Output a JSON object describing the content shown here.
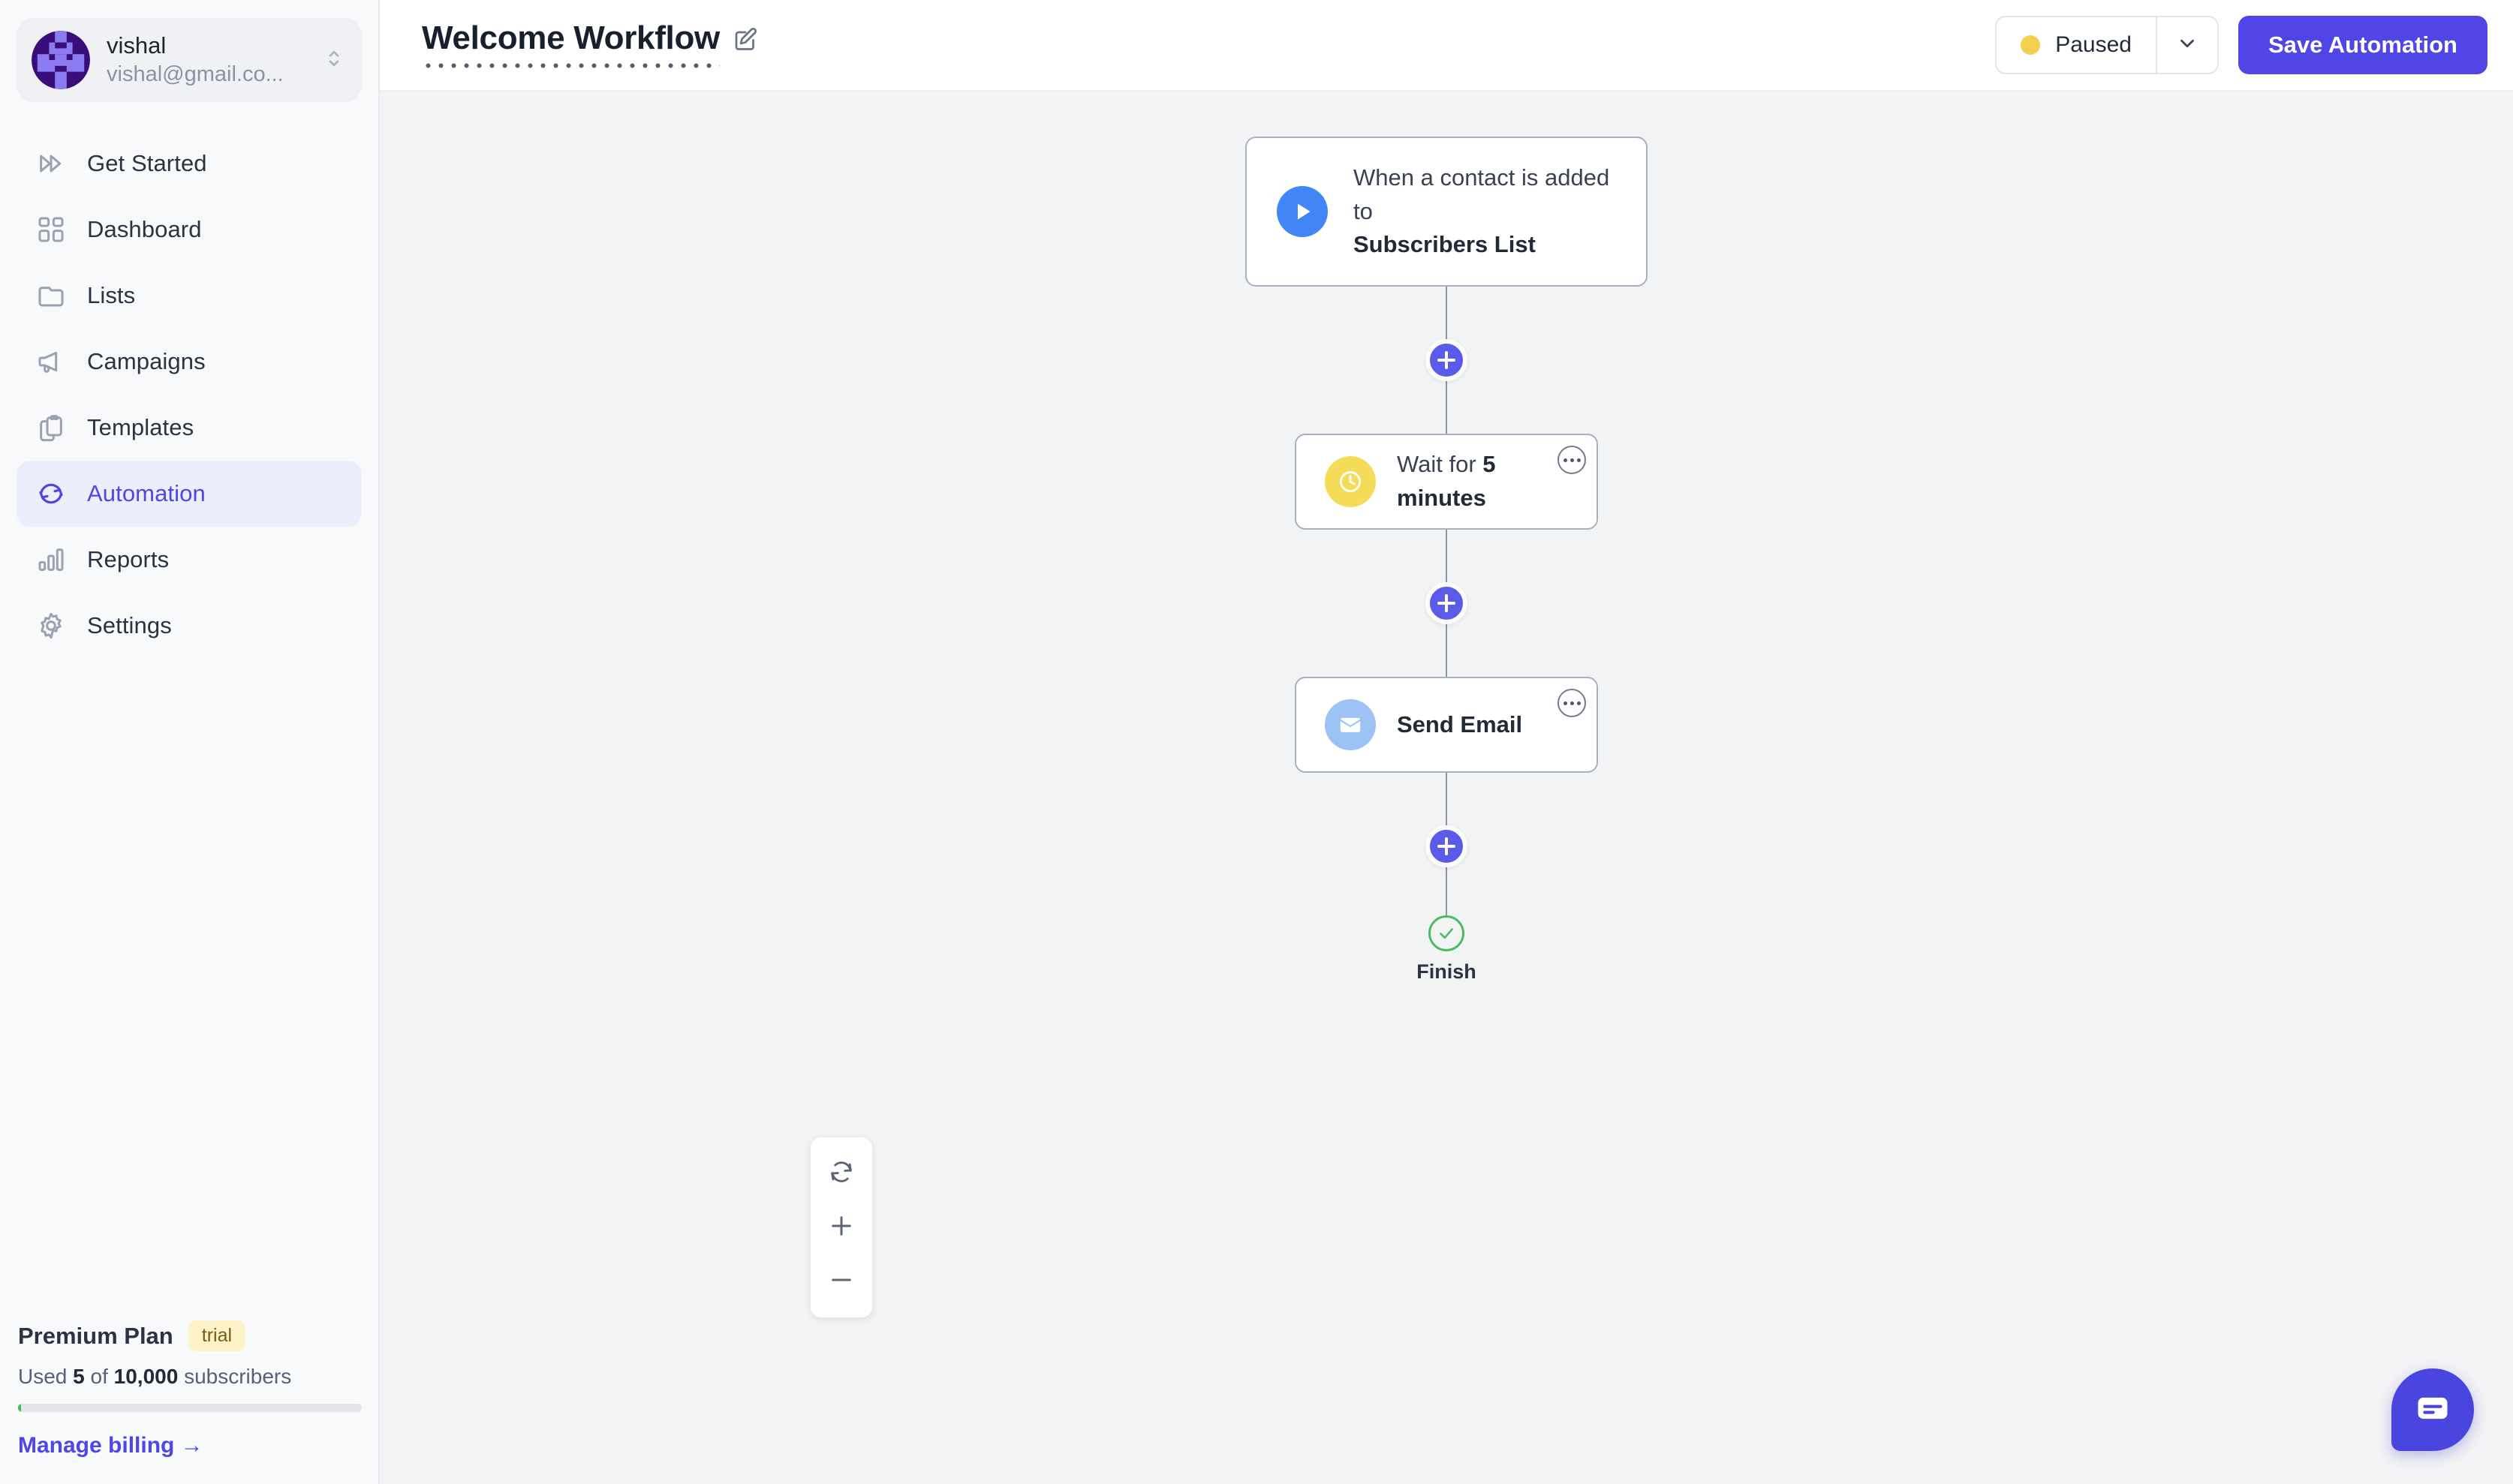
{
  "sidebar": {
    "account": {
      "name": "vishal",
      "email": "vishal@gmail.co...",
      "switch_icon": "chevron-up-down-icon",
      "avatar_icon": "identicon-avatar"
    },
    "items": [
      {
        "label": "Get Started",
        "icon": "fast-forward-icon",
        "active": false
      },
      {
        "label": "Dashboard",
        "icon": "grid-icon",
        "active": false
      },
      {
        "label": "Lists",
        "icon": "folder-icon",
        "active": false
      },
      {
        "label": "Campaigns",
        "icon": "megaphone-icon",
        "active": false
      },
      {
        "label": "Templates",
        "icon": "clipboard-copy-icon",
        "active": false
      },
      {
        "label": "Automation",
        "icon": "refresh-cycle-icon",
        "active": true
      },
      {
        "label": "Reports",
        "icon": "bar-chart-icon",
        "active": false
      },
      {
        "label": "Settings",
        "icon": "gear-icon",
        "active": false
      }
    ],
    "plan": {
      "name": "Premium Plan",
      "badge": "trial",
      "usage_prefix": "Used ",
      "usage_used": "5",
      "usage_mid": " of ",
      "usage_total": "10,000",
      "usage_suffix": " subscribers",
      "usage_percent": 0.8,
      "billing_link": "Manage billing →"
    }
  },
  "topbar": {
    "workflow_title": "Welcome Workflow",
    "edit_icon": "pencil-edit-icon",
    "status": {
      "label": "Paused",
      "dot_color": "#f3d04f",
      "caret_icon": "chevron-down-icon"
    },
    "save_label": "Save Automation",
    "accent_color": "#4f46e5"
  },
  "canvas": {
    "background_color": "#f2f3f5",
    "nodes": [
      {
        "type": "trigger",
        "icon": "play-icon",
        "icon_color": "#4285f4",
        "line1": "When a contact is added to",
        "line2": "Subscribers List",
        "has_menu": false
      },
      {
        "type": "wait",
        "icon": "clock-icon",
        "icon_color": "#f5dc58",
        "text_prefix": "Wait for ",
        "text_value": "5 minutes",
        "has_menu": true,
        "menu_icon": "ellipsis-icon"
      },
      {
        "type": "email",
        "icon": "envelope-icon",
        "icon_color": "#9cc3f4",
        "label": "Send Email",
        "has_menu": true,
        "menu_icon": "ellipsis-icon"
      }
    ],
    "add_button_icon": "plus-icon",
    "finish": {
      "label": "Finish",
      "icon": "check-circle-icon",
      "color": "#4cbb63"
    },
    "zoom_tools": [
      {
        "icon": "reset-view-icon",
        "name": "reset-view-button"
      },
      {
        "icon": "plus-icon",
        "name": "zoom-in-button"
      },
      {
        "icon": "minus-icon",
        "name": "zoom-out-button"
      }
    ]
  },
  "chat": {
    "icon": "chat-bubble-icon",
    "color": "#4b45e0"
  }
}
